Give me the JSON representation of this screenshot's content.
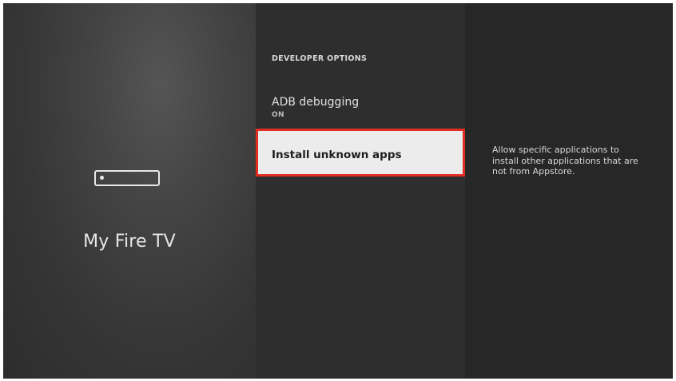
{
  "left_panel": {
    "title": "My Fire TV",
    "icon": "fire-tv-stick-icon"
  },
  "middle_panel": {
    "section_header": "DEVELOPER OPTIONS",
    "items": [
      {
        "label": "ADB debugging",
        "value": "ON",
        "selected": false
      },
      {
        "label": "Install unknown apps",
        "value": "",
        "selected": true
      }
    ]
  },
  "right_panel": {
    "description": "Allow specific applications to install other applications that are not from Appstore."
  },
  "colors": {
    "selection_border": "#e12d22",
    "selected_background": "#ececec",
    "panel_background": "#2e2e2e"
  }
}
